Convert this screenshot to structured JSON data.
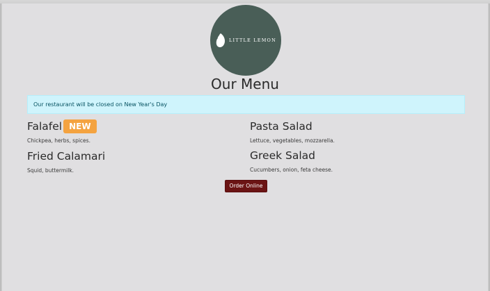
{
  "brand": {
    "logo_text": "LITTLE LEMON",
    "logo_bg": "#495e57"
  },
  "page_title": "Our Menu",
  "alert": {
    "message": "Our restaurant will be closed on New Year's Day",
    "bg": "#cff4fc"
  },
  "menu": {
    "items": [
      {
        "name": "Falafel",
        "badge": "NEW",
        "description": "Chickpea, herbs, spices."
      },
      {
        "name": "Pasta Salad",
        "description": "Lettuce, vegetables, mozzarella."
      },
      {
        "name": "Fried Calamari",
        "description": "Squid, buttermilk."
      },
      {
        "name": "Greek Salad",
        "description": "Cucumbers, onion, feta cheese."
      }
    ]
  },
  "order_button": {
    "label": "Order Online",
    "color": "#6b1414"
  },
  "badge_color": "#f4a340"
}
